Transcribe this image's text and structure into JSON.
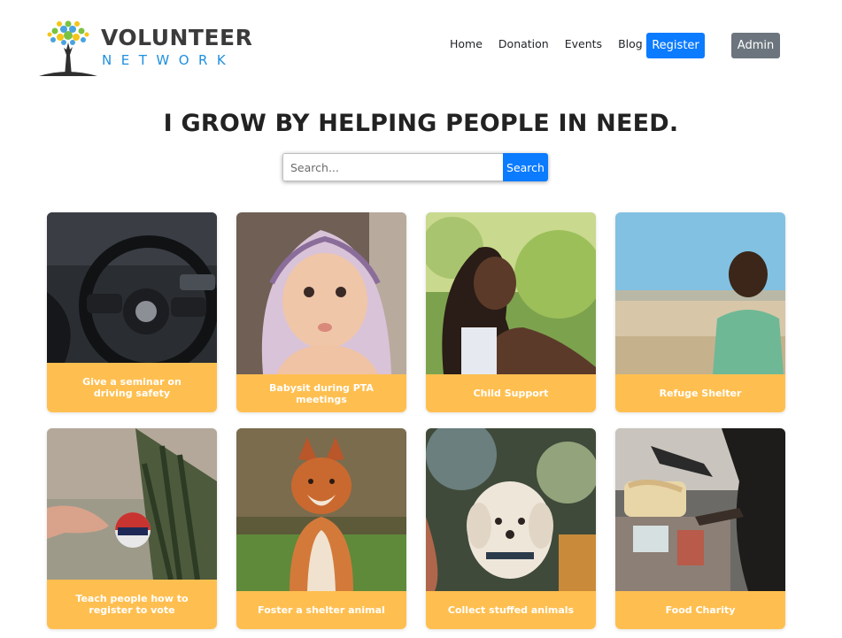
{
  "brand": {
    "line1": "VOLUNTEER",
    "line2": "NETWORK"
  },
  "nav": {
    "items": [
      "Home",
      "Donation",
      "Events",
      "Blog"
    ],
    "register": "Register",
    "admin": "Admin"
  },
  "hero": {
    "title": "I GROW BY HELPING PEOPLE IN NEED."
  },
  "search": {
    "placeholder": "Search...",
    "value": "",
    "button": "Search"
  },
  "cards": [
    {
      "title": "Give a seminar on driving safety",
      "image": "steering-wheel-photo"
    },
    {
      "title": "Babysit during PTA meetings",
      "image": "baby-photo"
    },
    {
      "title": "Child Support",
      "image": "smiling-girl-photo"
    },
    {
      "title": "Refuge Shelter",
      "image": "boy-in-field-photo"
    },
    {
      "title": "Teach people how to register to vote",
      "image": "i-voted-sticker-photo"
    },
    {
      "title": "Foster a shelter animal",
      "image": "fox-photo"
    },
    {
      "title": "Collect stuffed animals",
      "image": "white-dog-photo"
    },
    {
      "title": "Food Charity",
      "image": "food-market-photo"
    }
  ],
  "colors": {
    "accent": "#0b7bff",
    "caption_bg": "#ffbf50",
    "admin_bg": "#6c757d",
    "brand_blue": "#1f8fe0"
  }
}
